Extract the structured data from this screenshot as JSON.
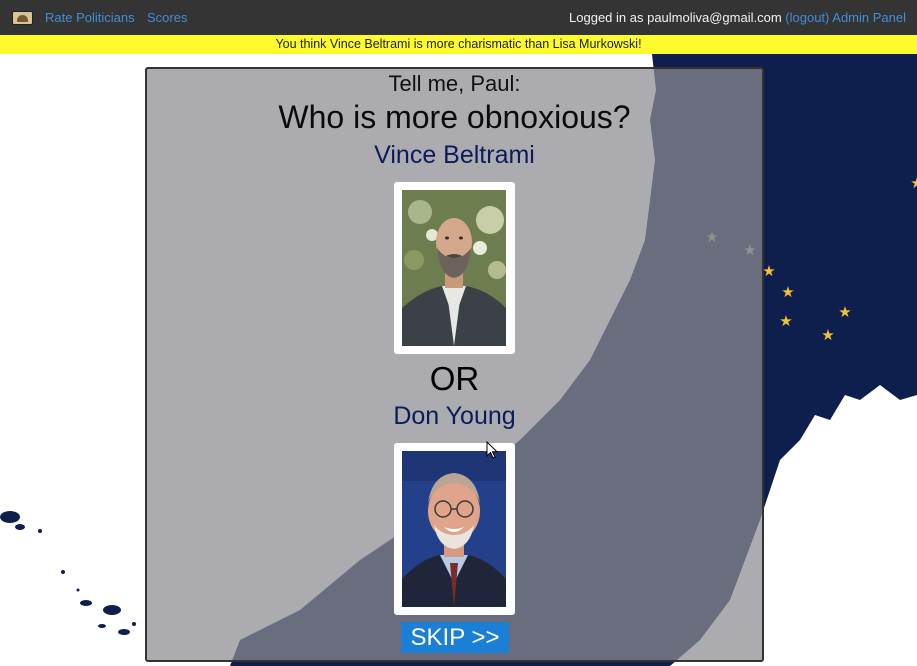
{
  "navbar": {
    "links": [
      {
        "label": "Rate Politicians"
      },
      {
        "label": "Scores"
      }
    ],
    "login_prefix": "Logged in as paulmoliva@gmail.com",
    "logout_label": "(logout)",
    "admin_label": "Admin Panel"
  },
  "banner": {
    "text": "You think Vince Beltrami is more charismatic than Lisa Murkowski!"
  },
  "card": {
    "greeting": "Tell me, Paul:",
    "question": "Who is more obnoxious?",
    "candidate_a": "Vince Beltrami",
    "or_text": "OR",
    "candidate_b": "Don Young",
    "skip_label": "SKIP >>"
  },
  "colors": {
    "navbar_bg": "#343434",
    "link": "#3f8ed9",
    "banner_bg": "#fdfb2e",
    "flag_navy": "#0f1f4d",
    "star_gold": "#f2c230",
    "skip_button": "#1b7fd6",
    "name_color": "#0c1b5a"
  },
  "icons": {
    "brand": "alaska-logo-icon",
    "cursor": "mouse-pointer-icon"
  }
}
